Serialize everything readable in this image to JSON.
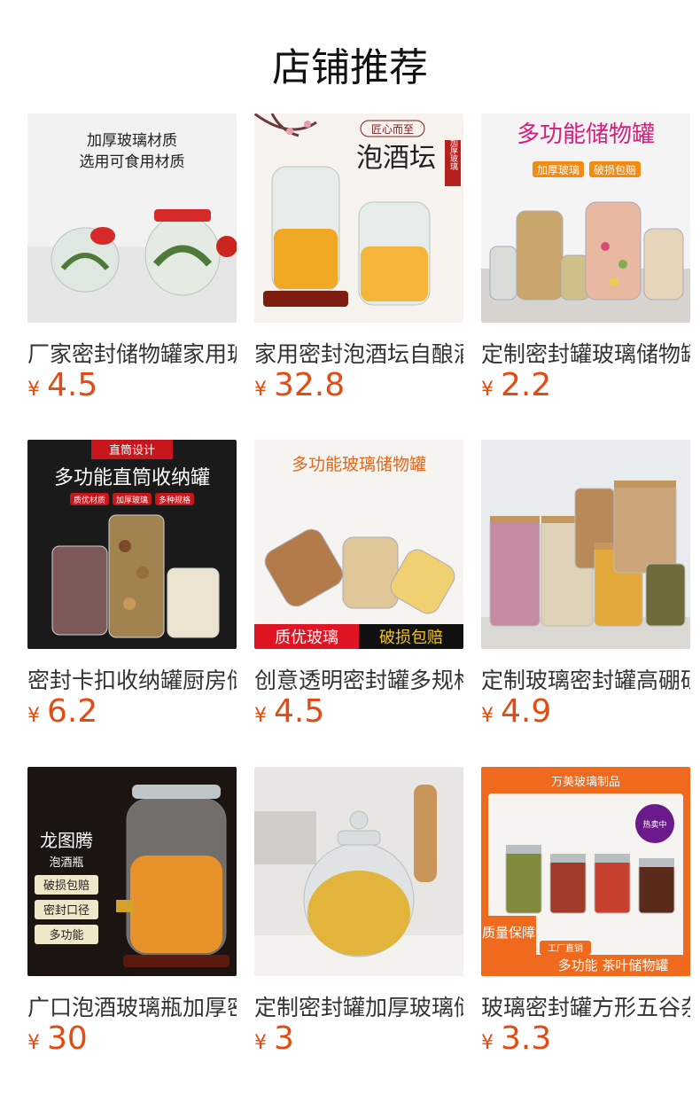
{
  "page_title": "店铺推荐",
  "colors": {
    "price": "#e24c12"
  },
  "products": [
    {
      "name": "厂家密封储物罐家用玻璃",
      "currency": "¥",
      "price": "4.5",
      "image_text": [
        "加厚玻璃材质",
        "选用可食用材质"
      ]
    },
    {
      "name": "家用密封泡酒坛自酿酒",
      "currency": "¥",
      "price": "32.8",
      "image_text": [
        "泡酒坛",
        "匠心而至",
        "加厚玻璃"
      ]
    },
    {
      "name": "定制密封罐玻璃储物罐",
      "currency": "¥",
      "price": "2.2",
      "image_text": [
        "多功能储物罐",
        "加厚玻璃",
        "破损包赔"
      ]
    },
    {
      "name": "密封卡扣收纳罐厨房储物",
      "currency": "¥",
      "price": "6.2",
      "image_text": [
        "直筒设计",
        "多功能直筒收纳罐",
        "质优材质",
        "加厚玻璃",
        "多种规格"
      ]
    },
    {
      "name": "创意透明密封罐多规格",
      "currency": "¥",
      "price": "4.5",
      "image_text": [
        "多功能玻璃储物罐",
        "质优玻璃",
        "破损包赔"
      ]
    },
    {
      "name": "定制玻璃密封罐高硼硅",
      "currency": "¥",
      "price": "4.9",
      "image_text": []
    },
    {
      "name": "广口泡酒玻璃瓶加厚密封",
      "currency": "¥",
      "price": "30",
      "image_text": [
        "龙图腾",
        "泡酒瓶",
        "破损包赔",
        "密封口径",
        "多功能"
      ]
    },
    {
      "name": "定制密封罐加厚玻璃储物",
      "currency": "¥",
      "price": "3",
      "image_text": []
    },
    {
      "name": "玻璃密封罐方形五谷杂粮",
      "currency": "¥",
      "price": "3.3",
      "image_text": [
        "万美玻璃制品",
        "热卖中",
        "质量保障",
        "工厂直销",
        "多功能 茶叶储物罐"
      ]
    }
  ]
}
